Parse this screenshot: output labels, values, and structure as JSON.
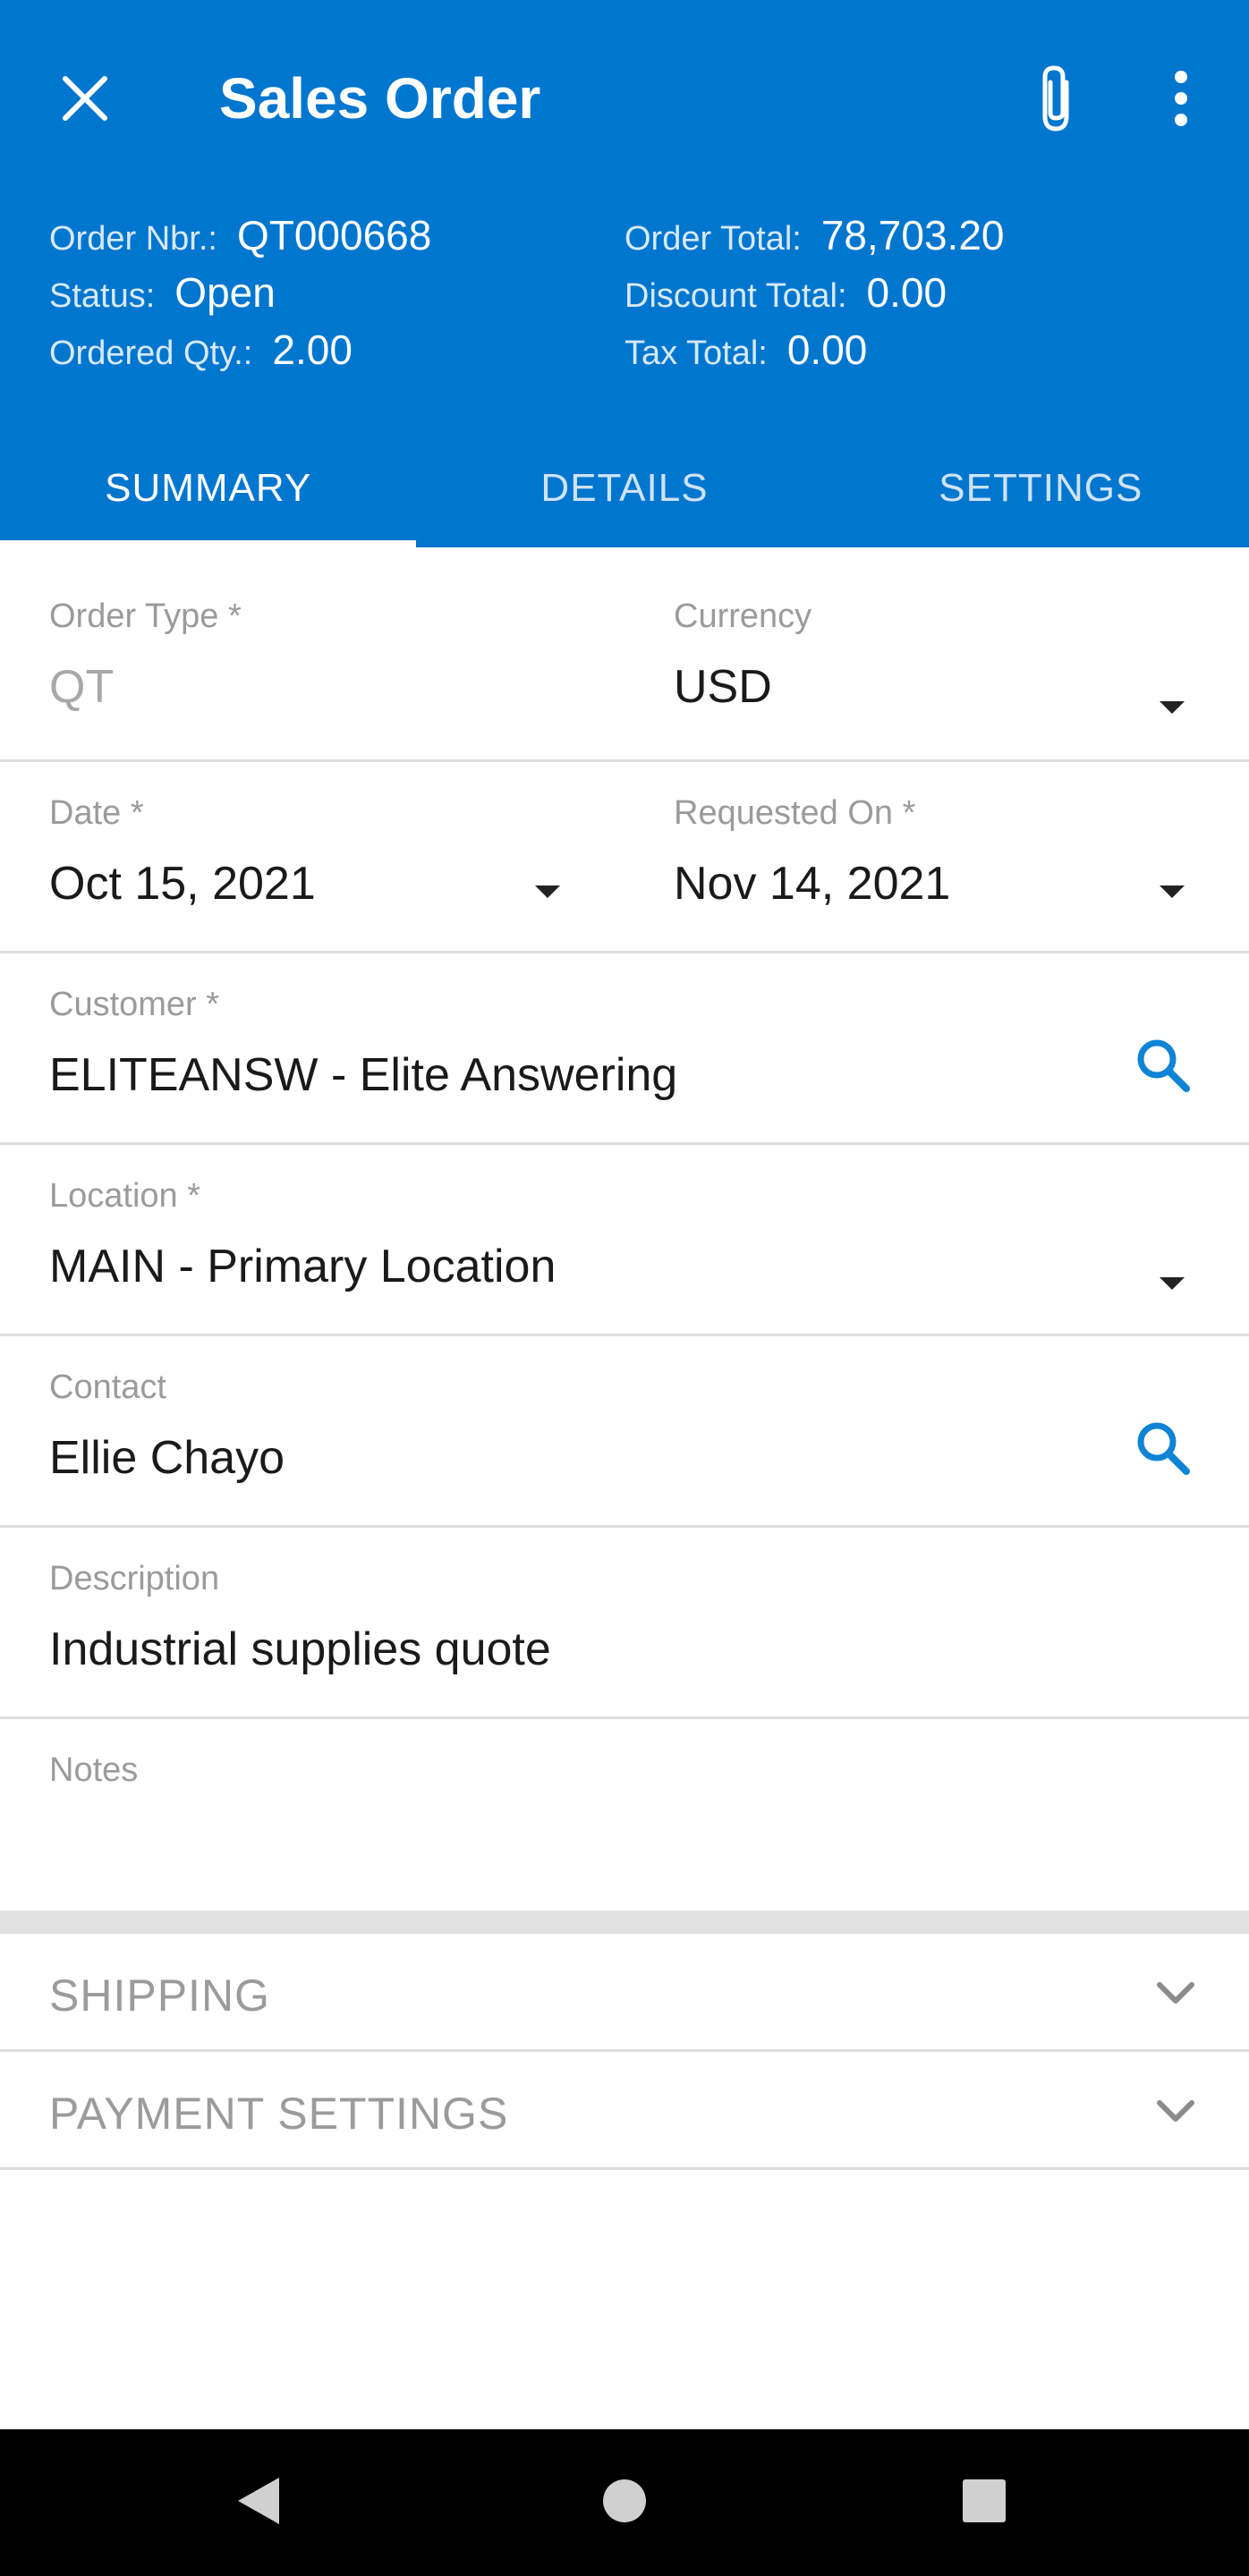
{
  "app": {
    "title": "Sales Order",
    "close_icon": "close-icon",
    "attach_icon": "paperclip-icon",
    "more_icon": "more-vert-icon"
  },
  "summary_info": {
    "order_nbr_label": "Order Nbr.:",
    "order_nbr_value": "QT000668",
    "status_label": "Status:",
    "status_value": "Open",
    "ordered_qty_label": "Ordered Qty.:",
    "ordered_qty_value": "2.00",
    "order_total_label": "Order Total:",
    "order_total_value": "78,703.20",
    "discount_total_label": "Discount Total:",
    "discount_total_value": "0.00",
    "tax_total_label": "Tax Total:",
    "tax_total_value": "0.00"
  },
  "tabs": [
    {
      "label": "SUMMARY",
      "active": true
    },
    {
      "label": "DETAILS",
      "active": false
    },
    {
      "label": "SETTINGS",
      "active": false
    }
  ],
  "form": {
    "order_type": {
      "label": "Order Type *",
      "value": "QT"
    },
    "currency": {
      "label": "Currency",
      "value": "USD"
    },
    "date": {
      "label": "Date *",
      "value": "Oct 15, 2021"
    },
    "requested_on": {
      "label": "Requested On *",
      "value": "Nov 14, 2021"
    },
    "customer": {
      "label": "Customer *",
      "value": "ELITEANSW - Elite Answering"
    },
    "location": {
      "label": "Location *",
      "value": "MAIN - Primary Location"
    },
    "contact": {
      "label": "Contact",
      "value": "Ellie Chayo"
    },
    "description": {
      "label": "Description",
      "value": "Industrial supplies quote"
    },
    "notes": {
      "label": "Notes",
      "value": ""
    }
  },
  "sections": [
    {
      "label": "SHIPPING"
    },
    {
      "label": "PAYMENT SETTINGS"
    }
  ],
  "colors": {
    "brand": "#0076cf",
    "accent_icon": "#0f84d4",
    "divider": "#dedede",
    "label_gray": "#9b9b9b"
  },
  "navbar": {
    "back_icon": "back-triangle-icon",
    "home_icon": "home-circle-icon",
    "recents_icon": "recents-square-icon"
  }
}
